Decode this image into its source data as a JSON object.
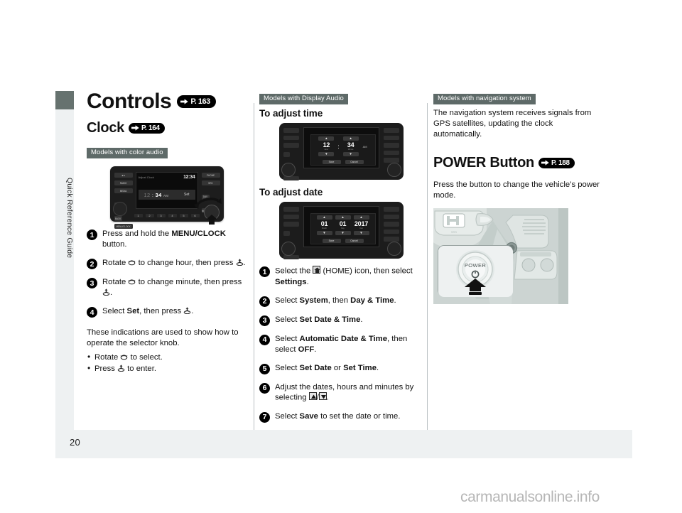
{
  "document": {
    "page_number": "20",
    "sidebar_label": "Quick Reference Guide",
    "watermark": "carmanualsonline.info"
  },
  "headings": {
    "controls": "Controls",
    "controls_ref": "P. 163",
    "clock": "Clock",
    "clock_ref": "P. 164",
    "power_button": "POWER Button",
    "power_button_ref": "P. 188"
  },
  "badges": {
    "color_audio": "Models with color audio",
    "display_audio": "Models with Display Audio",
    "navigation": "Models with navigation system"
  },
  "column_left": {
    "steps": [
      {
        "num": "1",
        "html": "Press and hold the <b>MENU/CLOCK</b> button."
      },
      {
        "num": "2",
        "html": "Rotate <span class=\"knob-rot\" data-icon=\"rotate-knob-icon\"></span> to change hour, then press <span class=\"knob-press\" data-icon=\"press-knob-icon\"></span>."
      },
      {
        "num": "3",
        "html": "Rotate <span class=\"knob-rot\" data-icon=\"rotate-knob-icon\"></span> to change minute, then press <span class=\"knob-press\" data-icon=\"press-knob-icon\"></span>."
      },
      {
        "num": "4",
        "html": "Select <b>Set</b>, then press <span class=\"knob-press\" data-icon=\"press-knob-icon\"></span>."
      }
    ],
    "note_paragraph": "These indications are used to show how to operate the selector knob.",
    "bullets": [
      "Rotate <span class=\"knob-rot\"></span> to select.",
      "Press <span class=\"knob-press\"></span> to enter."
    ]
  },
  "color_audio_unit": {
    "screen_title": "Adjust Clock",
    "status_clock": "12:34",
    "hour": "12",
    "minute": "34",
    "ampm": "AM",
    "set_label": "Set",
    "left_buttons": [
      "◄►",
      "RADIO",
      "MEDIA",
      "DISP",
      "BACK",
      "MENU/CLOCK"
    ],
    "right_buttons": [
      "PHONE",
      "SRC",
      "DAY",
      "NIGHT"
    ],
    "preset_numbers": [
      "1",
      "2",
      "3",
      "4",
      "5",
      "6"
    ]
  },
  "column_middle": {
    "section_time": "To adjust time",
    "section_date": "To adjust date",
    "time_screen": {
      "hour": "12",
      "hour_label": "Hour",
      "minute": "34",
      "minute_label": "Minute",
      "ampm": "AM",
      "save": "Save",
      "cancel": "Cancel",
      "up_glyph": "▲",
      "down_glyph": "▼"
    },
    "date_screen": {
      "month": "01",
      "month_label": "Month",
      "day": "01",
      "day_label": "Day",
      "year": "2017",
      "year_label": "Year",
      "save": "Save",
      "cancel": "Cancel",
      "up_glyph": "▲",
      "down_glyph": "▼"
    },
    "steps": [
      {
        "num": "1",
        "html": "Select the <span class=\"home-ico\" data-icon=\"home-icon\"></span> (HOME) icon, then select <b>Settings</b>."
      },
      {
        "num": "2",
        "html": "Select <b>System</b>, then <b>Day &amp; Time</b>."
      },
      {
        "num": "3",
        "html": "Select <b>Set Date &amp; Time</b>."
      },
      {
        "num": "4",
        "html": "Select <b>Automatic Date &amp; Time</b>, then select <b>OFF</b>."
      },
      {
        "num": "5",
        "html": "Select <b>Set Date</b> or <b>Set Time</b>."
      },
      {
        "num": "6",
        "html": "Adjust the dates, hours and minutes by selecting <span class=\"arrow-box\" data-icon=\"up-arrow-icon\"></span>/<span class=\"arrow-box\" data-icon=\"down-arrow-icon\"></span>."
      },
      {
        "num": "7",
        "html": "Select <b>Save</b> to set the date or time."
      }
    ]
  },
  "column_right": {
    "nav_paragraph": "The navigation system receives signals from GPS satellites, updating the clock automatically.",
    "power_paragraph": "Press the button to change the vehicle’s power mode.",
    "power_button_label": "POWER"
  },
  "colors": {
    "badge_bg": "#5e6a68",
    "sidebar_tab": "#66726f",
    "footer_band": "#eef1f2",
    "pill_bg": "#000000",
    "photo_bg": "#c9d2d0"
  }
}
